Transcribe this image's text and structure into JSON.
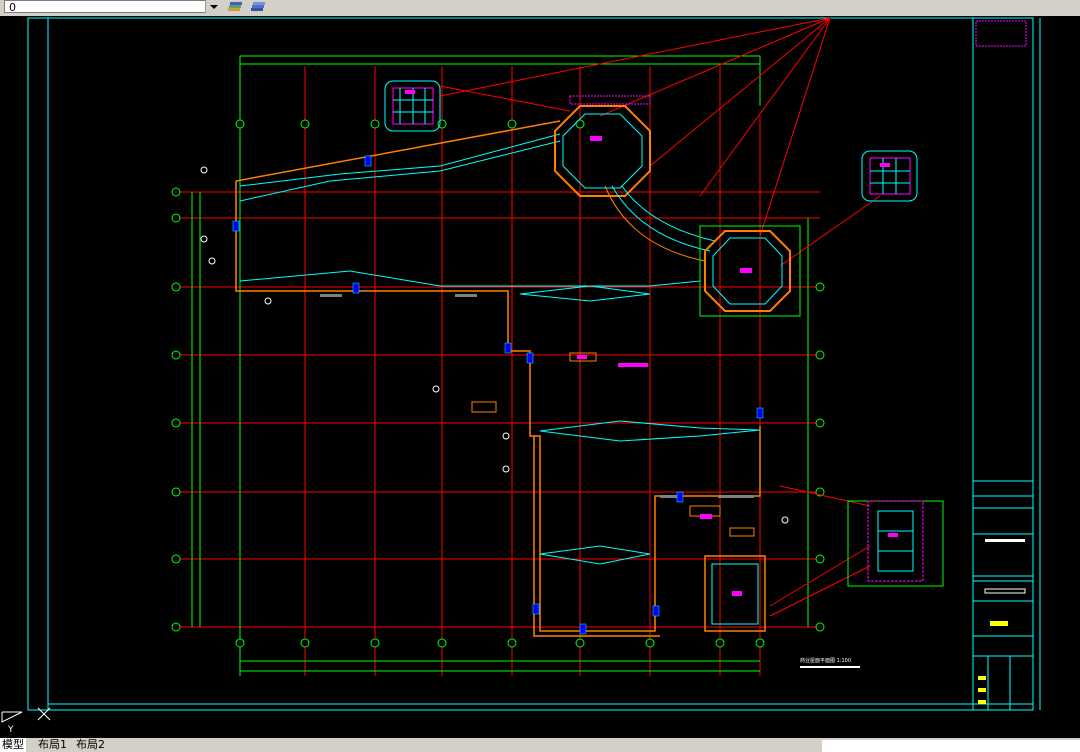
{
  "toolbar": {
    "layer_value": "0",
    "icons": [
      "layer-states-icon",
      "layer-previous-icon"
    ]
  },
  "tabs": [
    {
      "label": "模型",
      "active": true
    },
    {
      "label": "布局1",
      "active": false
    },
    {
      "label": "布局2",
      "active": false
    }
  ],
  "drawing": {
    "plan_title": "商业屋面平面图 1:100",
    "colors": {
      "background": "#000000",
      "axis_grid": "#ff0000",
      "dimension": "#00ff00",
      "wall_outline": "#ff8000",
      "frame": "#00ffff",
      "highlight": "#ff00ff",
      "column": "#0000ff",
      "tag": "#ffff00"
    }
  },
  "ucs_label": "Y"
}
